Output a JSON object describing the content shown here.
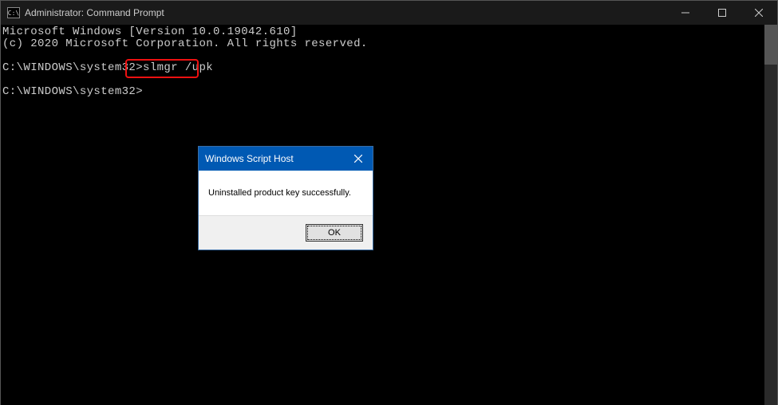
{
  "window": {
    "title": "Administrator: Command Prompt",
    "icon_text": "C:\\"
  },
  "console": {
    "line1": "Microsoft Windows [Version 10.0.19042.610]",
    "line2": "(c) 2020 Microsoft Corporation. All rights reserved.",
    "blank": "",
    "prompt1_path": "C:\\WINDOWS\\system32>",
    "prompt1_cmd": "slmgr /upk",
    "prompt2_path": "C:\\WINDOWS\\system32>"
  },
  "dialog": {
    "title": "Windows Script Host",
    "message": "Uninstalled product key successfully.",
    "ok_label": "OK"
  }
}
